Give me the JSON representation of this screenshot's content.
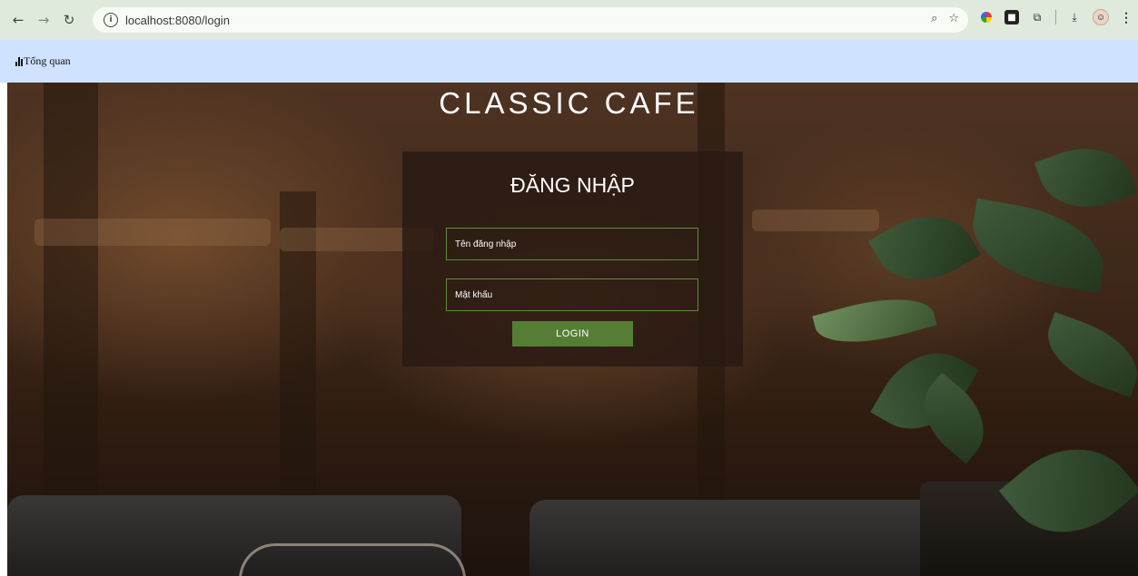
{
  "browser": {
    "url": "localhost:8080/login",
    "nav_icons": [
      "back-icon",
      "forward-icon",
      "reload-icon"
    ],
    "omnibox_icons": [
      "zoom-icon",
      "bookmark-star-icon"
    ],
    "extension_icons": [
      "colorful-extension-icon",
      "dark-extension-icon",
      "puzzle-icon",
      "download-icon",
      "profile-avatar-icon",
      "menu-icon"
    ]
  },
  "appnav": {
    "label": "Tổng quan",
    "icon": "bar-chart-icon",
    "background": "#cfe2ff"
  },
  "hero": {
    "brand_title": "CLASSIC CAFE"
  },
  "login": {
    "title": "ĐĂNG NHẬP",
    "username_placeholder": "Tên đăng nhập",
    "password_placeholder": "Mật khẩu",
    "button_label": "LOGIN",
    "accent_color": "#567d35"
  }
}
